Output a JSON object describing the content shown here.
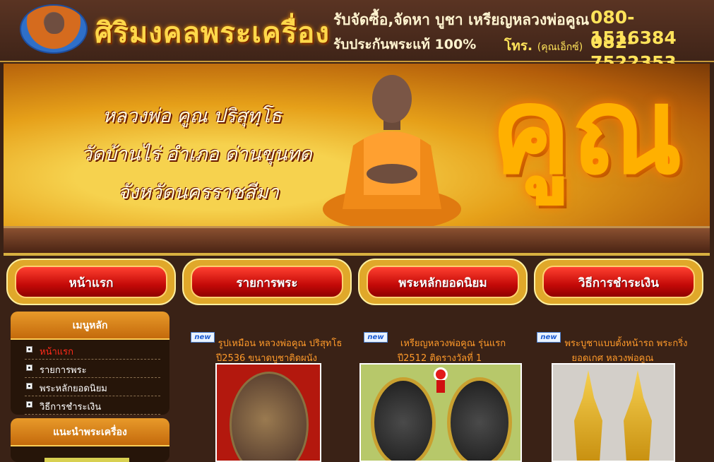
{
  "header": {
    "site_title": "ศิริมงคลพระเครื่อง",
    "contact_line1": "รับจัดซื้อ,จัดหา บูชา เหรียญหลวงพ่อคูณ",
    "contact_line2": "รับประกันพระแท้ 100%",
    "phone1": "080-1516384",
    "phone_label": "โทร.",
    "phone_contact": "(คุณเอ็กซ์)",
    "phone2": "082-7522353"
  },
  "banner": {
    "line1": "หลวงพ่อ คูณ ปริสุทฺโธ",
    "line2": "วัดบ้านไร่ อำเภอ ด่านขุนทด",
    "line3": "จังหวัดนครราชสีมา",
    "big_text": "คูณ"
  },
  "nav": {
    "items": [
      {
        "label": "หน้าแรก"
      },
      {
        "label": "รายการพระ"
      },
      {
        "label": "พระหลักยอดนิยม"
      },
      {
        "label": "วิธีการชำระเงิน"
      }
    ]
  },
  "sidebar": {
    "menu_title": "เมนูหลัก",
    "menu_items": [
      {
        "label": "หน้าแรก"
      },
      {
        "label": "รายการพระ"
      },
      {
        "label": "พระหลักยอดนิยม"
      },
      {
        "label": "วิธีการชำระเงิน"
      }
    ],
    "recommend_title": "แนะนำพระเครื่อง"
  },
  "products": [
    {
      "badge": "new",
      "title": "รูปเหมือน หลวงพ่อคูณ ปริสุทโธ ปี2536 ขนาดบูชาติดผนัง"
    },
    {
      "badge": "new",
      "title": "เหรียญหลวงพ่อคูณ รุ่นแรก ปี2512 ติดรางวัลที่ 1"
    },
    {
      "badge": "new",
      "title": "พระบูชาแบบตั้งหน้ารถ พระกริ่งยอดเกศ หลวงพ่อคูณ"
    }
  ],
  "colors": {
    "background": "#3a2216",
    "accent_gold": "#ffd84a",
    "nav_red": "#c40a08",
    "active_menu": "#ff2a1a",
    "product_title": "#ff9a2a"
  }
}
